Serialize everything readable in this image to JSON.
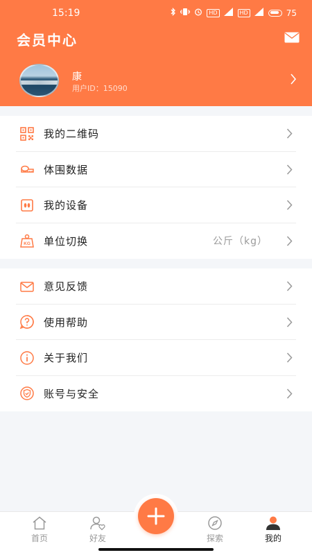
{
  "status_bar": {
    "time": "15:19",
    "battery": "75",
    "hd1": "HD",
    "hd2": "HD"
  },
  "header": {
    "title": "会员中心",
    "mail_icon": "mail-icon"
  },
  "profile": {
    "name": "康",
    "user_id": "用户ID：15090"
  },
  "section1": {
    "items": [
      {
        "label": "我的二维码",
        "icon": "qrcode-icon",
        "value": ""
      },
      {
        "label": "体围数据",
        "icon": "tape-measure-icon",
        "value": ""
      },
      {
        "label": "我的设备",
        "icon": "scale-device-icon",
        "value": ""
      },
      {
        "label": "单位切换",
        "icon": "weight-kg-icon",
        "value": "公斤（kg）"
      }
    ]
  },
  "section2": {
    "items": [
      {
        "label": "意见反馈",
        "icon": "mail-icon"
      },
      {
        "label": "使用帮助",
        "icon": "help-icon"
      },
      {
        "label": "关于我们",
        "icon": "info-icon"
      },
      {
        "label": "账号与安全",
        "icon": "shield-icon"
      }
    ]
  },
  "tabbar": {
    "tabs": [
      {
        "label": "首页",
        "icon": "home-icon"
      },
      {
        "label": "好友",
        "icon": "friends-icon"
      },
      {
        "label": "探索",
        "icon": "compass-icon"
      },
      {
        "label": "我的",
        "icon": "profile-icon"
      }
    ],
    "active": "我的"
  },
  "colors": {
    "accent": "#ff7a45",
    "background": "#f4f6f9"
  }
}
